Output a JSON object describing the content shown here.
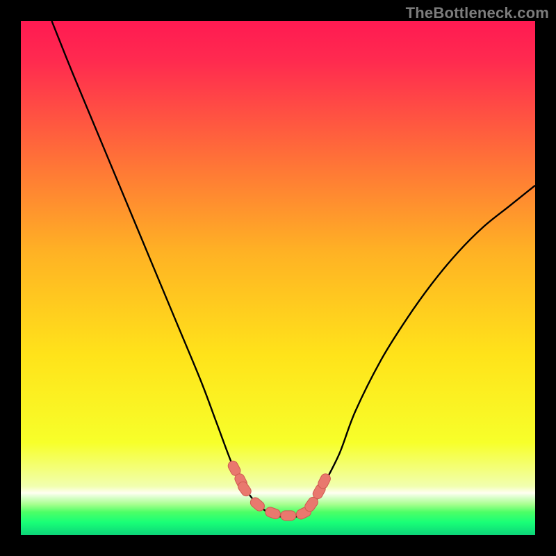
{
  "watermark": "TheBottleneck.com",
  "colors": {
    "frame": "#000000",
    "curve": "#000000",
    "marker_fill": "#e9786e",
    "marker_stroke": "#cf5a50",
    "gradient_stops": [
      {
        "offset": 0.0,
        "color": "#ff1a52"
      },
      {
        "offset": 0.08,
        "color": "#ff2b4f"
      },
      {
        "offset": 0.25,
        "color": "#ff6a3a"
      },
      {
        "offset": 0.45,
        "color": "#ffb224"
      },
      {
        "offset": 0.65,
        "color": "#ffe31a"
      },
      {
        "offset": 0.82,
        "color": "#f7ff2a"
      },
      {
        "offset": 0.905,
        "color": "#f1ffb0"
      },
      {
        "offset": 0.918,
        "color": "#fffff2"
      },
      {
        "offset": 0.928,
        "color": "#d4ffc4"
      },
      {
        "offset": 0.94,
        "color": "#a8ff8f"
      },
      {
        "offset": 0.955,
        "color": "#4dff66"
      },
      {
        "offset": 0.975,
        "color": "#19ff77"
      },
      {
        "offset": 1.0,
        "color": "#0cd478"
      }
    ]
  },
  "chart_data": {
    "type": "line",
    "title": "",
    "xlabel": "",
    "ylabel": "",
    "xlim": [
      0,
      100
    ],
    "ylim": [
      0,
      100
    ],
    "grid": false,
    "legend": false,
    "series": [
      {
        "name": "bottleneck-curve",
        "x": [
          6,
          10,
          15,
          20,
          25,
          30,
          35,
          38,
          41,
          43,
          46,
          49,
          52,
          55,
          57,
          59,
          62,
          65,
          70,
          75,
          80,
          85,
          90,
          95,
          100
        ],
        "y": [
          100,
          90,
          78,
          66,
          54,
          42,
          30,
          22,
          14,
          10,
          6,
          4,
          3.5,
          4,
          6,
          10,
          16,
          24,
          34,
          42,
          49,
          55,
          60,
          64,
          68
        ]
      }
    ],
    "markers": {
      "name": "highlight-points",
      "x": [
        41.5,
        42.8,
        43.5,
        46,
        49,
        52,
        55,
        56.5,
        58,
        59.0
      ],
      "y": [
        13,
        10.5,
        9,
        6,
        4.3,
        3.8,
        4.3,
        6,
        8.5,
        10.5
      ],
      "style": "pill"
    },
    "annotations": []
  }
}
